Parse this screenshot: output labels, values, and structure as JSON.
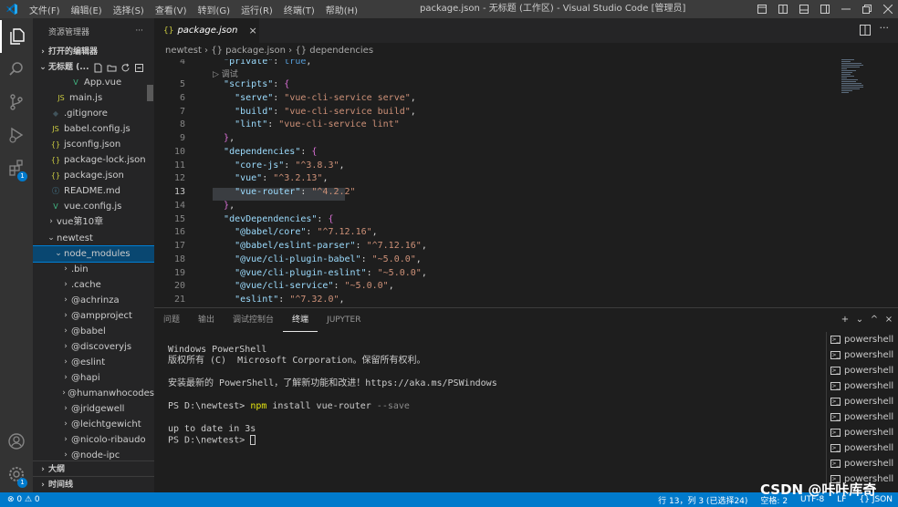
{
  "menu": [
    "文件(F)",
    "编辑(E)",
    "选择(S)",
    "查看(V)",
    "转到(G)",
    "运行(R)",
    "终端(T)",
    "帮助(H)"
  ],
  "window_title": "package.json - 无标题 (工作区) - Visual Studio Code [管理员]",
  "explorer": {
    "title": "资源管理器",
    "more": "···",
    "open_editors": "打开的编辑器",
    "workspace": "无标题 (...",
    "outline": "大纲",
    "timeline": "时间线"
  },
  "tree": [
    {
      "label": "App.vue",
      "icon": "V",
      "color": "#41b883",
      "indent": 40
    },
    {
      "label": "main.js",
      "icon": "JS",
      "color": "#cbcb41",
      "indent": 24
    },
    {
      "label": ".gitignore",
      "icon": "◆",
      "color": "#41535b",
      "indent": 18
    },
    {
      "label": "babel.config.js",
      "icon": "JS",
      "color": "#cbcb41",
      "indent": 18
    },
    {
      "label": "jsconfig.json",
      "icon": "{}",
      "color": "#cbcb41",
      "indent": 18
    },
    {
      "label": "package-lock.json",
      "icon": "{}",
      "color": "#cbcb41",
      "indent": 18
    },
    {
      "label": "package.json",
      "icon": "{}",
      "color": "#cbcb41",
      "indent": 18
    },
    {
      "label": "README.md",
      "icon": "ⓘ",
      "color": "#519aba",
      "indent": 18
    },
    {
      "label": "vue.config.js",
      "icon": "V",
      "color": "#41b883",
      "indent": 18
    },
    {
      "label": "vue第10章",
      "chev": "›",
      "indent": 14
    },
    {
      "label": "newtest",
      "chev": "⌄",
      "indent": 14
    },
    {
      "label": "node_modules",
      "chev": "⌄",
      "indent": 22,
      "selected": true
    },
    {
      "label": ".bin",
      "chev": "›",
      "indent": 30
    },
    {
      "label": ".cache",
      "chev": "›",
      "indent": 30
    },
    {
      "label": "@achrinza",
      "chev": "›",
      "indent": 30
    },
    {
      "label": "@ampproject",
      "chev": "›",
      "indent": 30
    },
    {
      "label": "@babel",
      "chev": "›",
      "indent": 30
    },
    {
      "label": "@discoveryjs",
      "chev": "›",
      "indent": 30
    },
    {
      "label": "@eslint",
      "chev": "›",
      "indent": 30
    },
    {
      "label": "@hapi",
      "chev": "›",
      "indent": 30
    },
    {
      "label": "@humanwhocodes",
      "chev": "›",
      "indent": 30
    },
    {
      "label": "@jridgewell",
      "chev": "›",
      "indent": 30
    },
    {
      "label": "@leichtgewicht",
      "chev": "›",
      "indent": 30
    },
    {
      "label": "@nicolo-ribaudo",
      "chev": "›",
      "indent": 30
    },
    {
      "label": "@node-ipc",
      "chev": "›",
      "indent": 30
    }
  ],
  "tab": {
    "icon": "{}",
    "name": "package.json",
    "close": "×"
  },
  "breadcrumb": "newtest  ›  {} package.json  ›  {} dependencies",
  "codelens": "▷ 调试",
  "code_lines": [
    {
      "n": "4",
      "html": "  <span class='k'>\"private\"</span><span class='p'>: </span><span class='b'>true</span><span class='p'>,</span>"
    },
    {
      "n": "5",
      "html": "  <span class='k'>\"scripts\"</span><span class='p'>: </span><span class='br2'>{</span>"
    },
    {
      "n": "6",
      "html": "    <span class='k'>\"serve\"</span><span class='p'>: </span><span class='s'>\"vue-cli-service serve\"</span><span class='p'>,</span>"
    },
    {
      "n": "7",
      "html": "    <span class='k'>\"build\"</span><span class='p'>: </span><span class='s'>\"vue-cli-service build\"</span><span class='p'>,</span>"
    },
    {
      "n": "8",
      "html": "    <span class='k'>\"lint\"</span><span class='p'>: </span><span class='s'>\"vue-cli-service lint\"</span>"
    },
    {
      "n": "9",
      "html": "  <span class='br2'>}</span><span class='p'>,</span>"
    },
    {
      "n": "10",
      "html": "  <span class='k'>\"dependencies\"</span><span class='p'>: </span><span class='br2'>{</span>"
    },
    {
      "n": "11",
      "html": "    <span class='k'>\"core-js\"</span><span class='p'>: </span><span class='s'>\"^3.8.3\"</span><span class='p'>,</span>"
    },
    {
      "n": "12",
      "html": "    <span class='k'>\"vue\"</span><span class='p'>: </span><span class='s'>\"^3.2.13\"</span><span class='p'>,</span>"
    },
    {
      "n": "13",
      "html": "    <span class='k'>\"vue-router\"</span><span class='p'>: </span><span class='s'>\"^4.2.2\"</span>"
    },
    {
      "n": "14",
      "html": "  <span class='br2'>}</span><span class='p'>,</span>"
    },
    {
      "n": "15",
      "html": "  <span class='k'>\"devDependencies\"</span><span class='p'>: </span><span class='br2'>{</span>"
    },
    {
      "n": "16",
      "html": "    <span class='k'>\"@babel/core\"</span><span class='p'>: </span><span class='s'>\"^7.12.16\"</span><span class='p'>,</span>"
    },
    {
      "n": "17",
      "html": "    <span class='k'>\"@babel/eslint-parser\"</span><span class='p'>: </span><span class='s'>\"^7.12.16\"</span><span class='p'>,</span>"
    },
    {
      "n": "18",
      "html": "    <span class='k'>\"@vue/cli-plugin-babel\"</span><span class='p'>: </span><span class='s'>\"~5.0.0\"</span><span class='p'>,</span>"
    },
    {
      "n": "19",
      "html": "    <span class='k'>\"@vue/cli-plugin-eslint\"</span><span class='p'>: </span><span class='s'>\"~5.0.0\"</span><span class='p'>,</span>"
    },
    {
      "n": "20",
      "html": "    <span class='k'>\"@vue/cli-service\"</span><span class='p'>: </span><span class='s'>\"~5.0.0\"</span><span class='p'>,</span>"
    },
    {
      "n": "21",
      "html": "    <span class='k'>\"eslint\"</span><span class='p'>: </span><span class='s'>\"^7.32.0\"</span><span class='p'>,</span>"
    }
  ],
  "panel_tabs": [
    "问题",
    "输出",
    "调试控制台",
    "终端",
    "JUPYTER"
  ],
  "panel_active": "终端",
  "panel_actions": {
    "add": "+",
    "dropdown": "⌄",
    "maximize": "^",
    "close": "×"
  },
  "terminal": {
    "l1": "Windows PowerShell",
    "l2": "版权所有 (C)  Microsoft Corporation。保留所有权利。",
    "l3": "安装最新的 PowerShell，了解新功能和改进！https://aka.ms/PSWindows",
    "prompt1": "PS D:\\newtest> ",
    "cmd": "npm",
    "args": " install vue-router ",
    "flag": "--save",
    "l5": "up to date in 3s",
    "prompt2": "PS D:\\newtest> "
  },
  "terminal_list": [
    "powershell",
    "powershell",
    "powershell",
    "powershell",
    "powershell",
    "powershell",
    "powershell",
    "powershell",
    "powershell",
    "powershell"
  ],
  "status": {
    "left": "⊗ 0  ⚠ 0",
    "position": "行 13，列 3 (已选择24)",
    "spaces": "空格: 2",
    "encoding": "UTF-8",
    "eol": "LF",
    "lang": "{} JSON"
  },
  "watermark": "CSDN @咔咔库奇",
  "colors": {
    "accent": "#007acc",
    "selection": "#094771"
  }
}
